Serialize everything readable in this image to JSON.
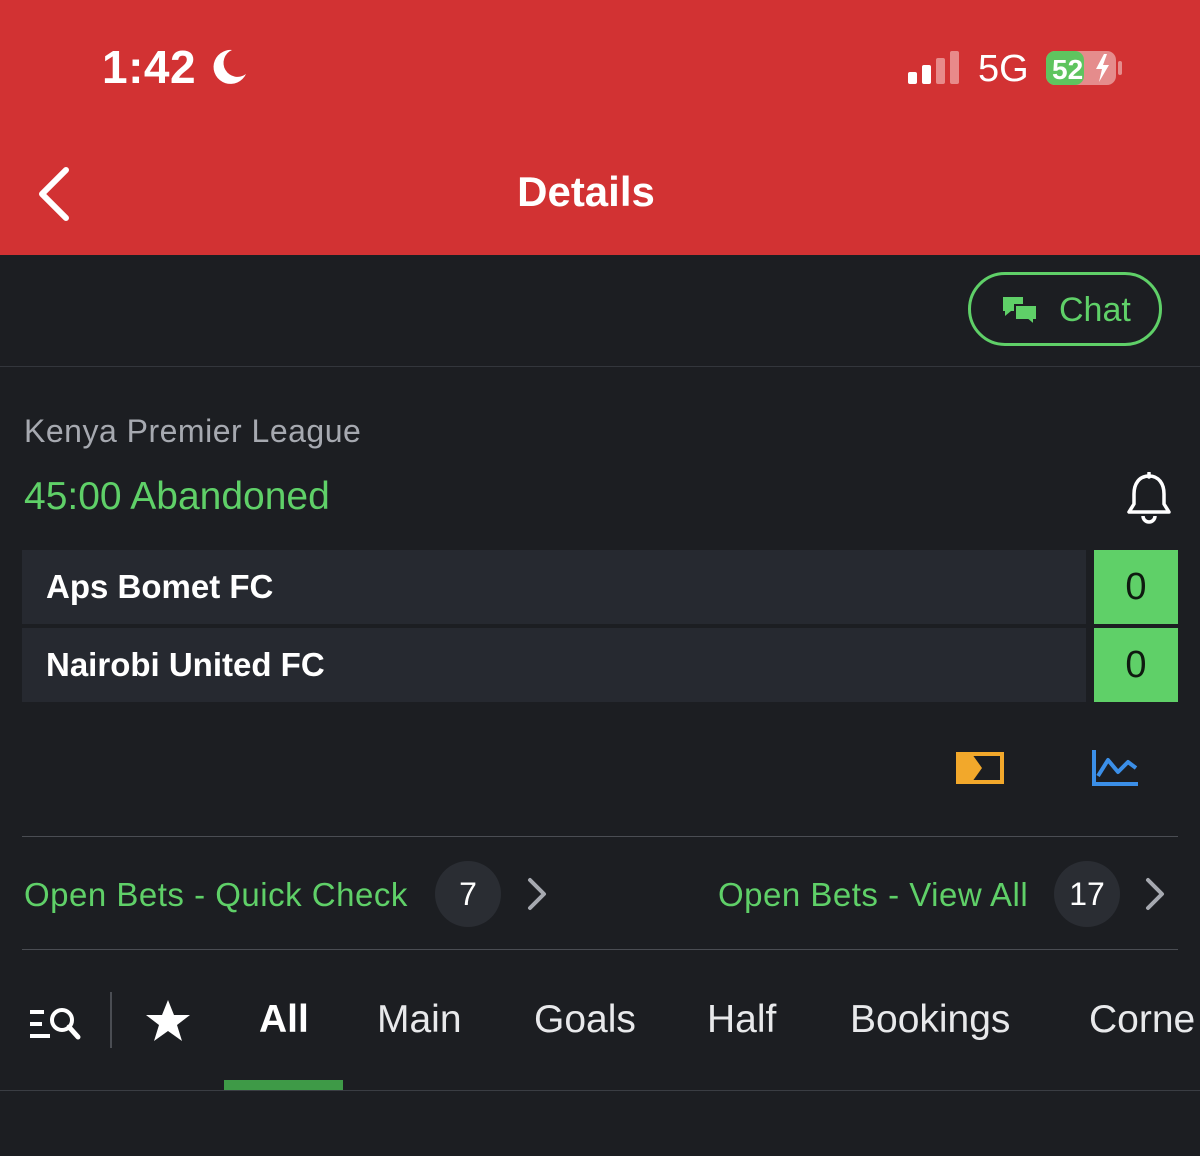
{
  "status_bar": {
    "time": "1:42",
    "network": "5G",
    "battery": "52"
  },
  "header": {
    "title": "Details"
  },
  "chat": {
    "label": "Chat"
  },
  "match": {
    "league": "Kenya Premier League",
    "status": "45:00 Abandoned",
    "teams": [
      {
        "name": "Aps Bomet FC",
        "score": "0"
      },
      {
        "name": "Nairobi United FC",
        "score": "0"
      }
    ]
  },
  "open_bets": {
    "quick_check_label": "Open Bets - Quick Check",
    "quick_check_count": "7",
    "view_all_label": "Open Bets - View All",
    "view_all_count": "17"
  },
  "tabs": [
    {
      "label": "All",
      "active": true
    },
    {
      "label": "Main"
    },
    {
      "label": "Goals"
    },
    {
      "label": "Half"
    },
    {
      "label": "Bookings"
    },
    {
      "label": "Corne"
    }
  ],
  "icons": {
    "moon": "moon-icon",
    "signal": "cellular-signal-icon",
    "battery": "battery-charging-icon",
    "back": "chevron-left-icon",
    "chat": "chat-bubbles-icon",
    "bell": "bell-icon",
    "tv": "live-stream-icon",
    "stats": "line-chart-icon",
    "search": "search-filter-icon",
    "star": "star-icon"
  },
  "colors": {
    "header": "#d23233",
    "background": "#1c1e22",
    "accent_green": "#5fd068",
    "row_bg": "#262930",
    "tv_icon": "#f2a82b",
    "stats_icon": "#3b8fe8"
  }
}
